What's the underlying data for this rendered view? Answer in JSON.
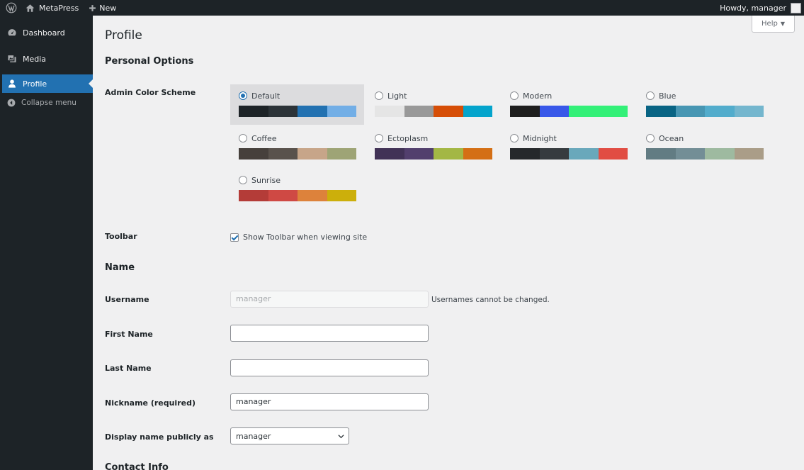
{
  "adminbar": {
    "site_name": "MetaPress",
    "new_label": "New",
    "greeting": "Howdy, manager"
  },
  "sidebar": {
    "items": [
      {
        "label": "Dashboard",
        "icon": "dashboard-icon"
      },
      {
        "label": "Media",
        "icon": "media-icon"
      },
      {
        "label": "Profile",
        "icon": "user-icon",
        "current": true
      }
    ],
    "collapse_label": "Collapse menu"
  },
  "help_label": "Help",
  "page_title": "Profile",
  "personal_options": {
    "title": "Personal Options",
    "color_scheme_label": "Admin Color Scheme",
    "schemes": [
      {
        "name": "Default",
        "selected": true,
        "colors": [
          "#1d2327",
          "#2c3338",
          "#2271b1",
          "#72aee6"
        ]
      },
      {
        "name": "Light",
        "selected": false,
        "colors": [
          "#e5e5e5",
          "#999999",
          "#d64e07",
          "#04a4cc"
        ]
      },
      {
        "name": "Modern",
        "selected": false,
        "colors": [
          "#1e1e1e",
          "#3858e9",
          "#33f078",
          "#33f078"
        ]
      },
      {
        "name": "Blue",
        "selected": false,
        "colors": [
          "#096484",
          "#4796b3",
          "#52accc",
          "#74b6ce"
        ]
      },
      {
        "name": "Coffee",
        "selected": false,
        "colors": [
          "#46403c",
          "#59524c",
          "#c7a589",
          "#9ea476"
        ]
      },
      {
        "name": "Ectoplasm",
        "selected": false,
        "colors": [
          "#413256",
          "#523f6d",
          "#a3b745",
          "#d46f15"
        ]
      },
      {
        "name": "Midnight",
        "selected": false,
        "colors": [
          "#25282b",
          "#363b3f",
          "#69a8bb",
          "#e14d43"
        ]
      },
      {
        "name": "Ocean",
        "selected": false,
        "colors": [
          "#627c83",
          "#738e96",
          "#9ebaa0",
          "#aa9d88"
        ]
      },
      {
        "name": "Sunrise",
        "selected": false,
        "colors": [
          "#b43c38",
          "#cf4944",
          "#dd823b",
          "#ccaf0b"
        ]
      }
    ],
    "toolbar_label": "Toolbar",
    "toolbar_checkbox_label": "Show Toolbar when viewing site",
    "toolbar_checked": true
  },
  "name_section": {
    "title": "Name",
    "username_label": "Username",
    "username_value": "manager",
    "username_note": "Usernames cannot be changed.",
    "first_name_label": "First Name",
    "first_name_value": "",
    "last_name_label": "Last Name",
    "last_name_value": "",
    "nickname_label": "Nickname (required)",
    "nickname_value": "manager",
    "display_name_label": "Display name publicly as",
    "display_name_value": "manager"
  },
  "contact_section": {
    "title": "Contact Info"
  }
}
